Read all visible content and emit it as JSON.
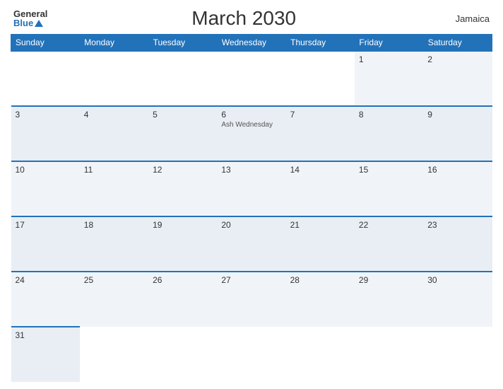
{
  "header": {
    "logo_general": "General",
    "logo_blue": "Blue",
    "title": "March 2030",
    "country": "Jamaica"
  },
  "days_of_week": [
    "Sunday",
    "Monday",
    "Tuesday",
    "Wednesday",
    "Thursday",
    "Friday",
    "Saturday"
  ],
  "weeks": [
    [
      {
        "day": "",
        "empty": true
      },
      {
        "day": "",
        "empty": true
      },
      {
        "day": "",
        "empty": true
      },
      {
        "day": "",
        "empty": true
      },
      {
        "day": "",
        "empty": true
      },
      {
        "day": "1"
      },
      {
        "day": "2"
      }
    ],
    [
      {
        "day": "3"
      },
      {
        "day": "4"
      },
      {
        "day": "5"
      },
      {
        "day": "6",
        "event": "Ash Wednesday"
      },
      {
        "day": "7"
      },
      {
        "day": "8"
      },
      {
        "day": "9"
      }
    ],
    [
      {
        "day": "10"
      },
      {
        "day": "11"
      },
      {
        "day": "12"
      },
      {
        "day": "13"
      },
      {
        "day": "14"
      },
      {
        "day": "15"
      },
      {
        "day": "16"
      }
    ],
    [
      {
        "day": "17"
      },
      {
        "day": "18"
      },
      {
        "day": "19"
      },
      {
        "day": "20"
      },
      {
        "day": "21"
      },
      {
        "day": "22"
      },
      {
        "day": "23"
      }
    ],
    [
      {
        "day": "24"
      },
      {
        "day": "25"
      },
      {
        "day": "26"
      },
      {
        "day": "27"
      },
      {
        "day": "28"
      },
      {
        "day": "29"
      },
      {
        "day": "30"
      }
    ],
    [
      {
        "day": "31"
      },
      {
        "day": "",
        "empty": true
      },
      {
        "day": "",
        "empty": true
      },
      {
        "day": "",
        "empty": true
      },
      {
        "day": "",
        "empty": true
      },
      {
        "day": "",
        "empty": true
      },
      {
        "day": "",
        "empty": true
      }
    ]
  ]
}
